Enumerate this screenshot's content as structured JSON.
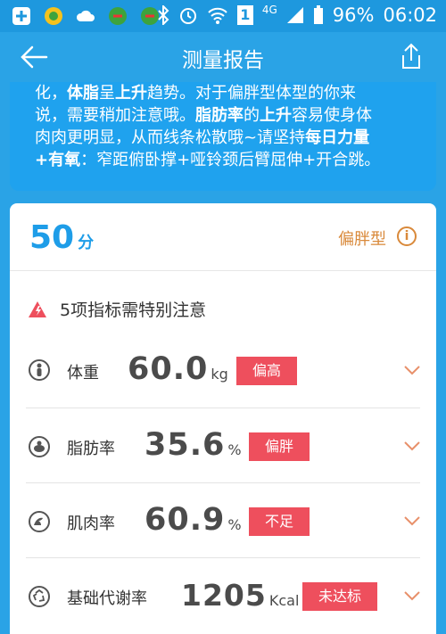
{
  "status_bar": {
    "battery": "96%",
    "time": "06:02",
    "network": "4G",
    "sim": "1",
    "left_icons": [
      "plus-icon",
      "app-icon",
      "cloud-icon",
      "app-icon-2",
      "app-icon-3"
    ],
    "right_icons": [
      "bluetooth-icon",
      "alarm-icon",
      "wifi-icon",
      "sim-icon",
      "signal-icon",
      "battery-icon"
    ]
  },
  "app_bar": {
    "title": "测量报告",
    "back_icon": "arrow-left-icon",
    "share_icon": "share-icon"
  },
  "advice": {
    "line1_a": "化，",
    "line1_b": "体脂",
    "line1_c": "呈",
    "line1_d": "上升",
    "line1_e": "趋势。对于偏胖型体型的你来",
    "line2_a": "说，需要稍加注意哦。",
    "line2_b": "脂肪率",
    "line2_c": "的",
    "line2_d": "上升",
    "line2_e": "容易使身体",
    "line3_a": "肉肉更明显，从而线条松散哦~请坚持",
    "line3_b": "每日力量",
    "line4_a": "+有氧",
    "line4_b": "：窄距俯卧撑+哑铃颈后臂屈伸+开合跳。"
  },
  "summary": {
    "score": "50",
    "score_unit": "分",
    "body_type": "偏胖型",
    "info_icon": "i"
  },
  "warning": {
    "text": "5项指标需特别注意",
    "icon": "warning-triangle-icon"
  },
  "metrics": [
    {
      "label": "体重",
      "value": "60.0",
      "unit": "kg",
      "status": "偏高",
      "icon": "person-icon"
    },
    {
      "label": "脂肪率",
      "value": "35.6",
      "unit": "%",
      "status": "偏胖",
      "icon": "fat-icon"
    },
    {
      "label": "肌肉率",
      "value": "60.9",
      "unit": "%",
      "status": "不足",
      "icon": "muscle-icon"
    },
    {
      "label": "基础代谢率",
      "value": "1205",
      "unit": "Kcal",
      "status": "未达标",
      "icon": "recycle-icon"
    }
  ],
  "colors": {
    "header": "#2aa3e6",
    "score": "#1e9de8",
    "body_type": "#d9893a",
    "badge": "#ee4f5d"
  }
}
